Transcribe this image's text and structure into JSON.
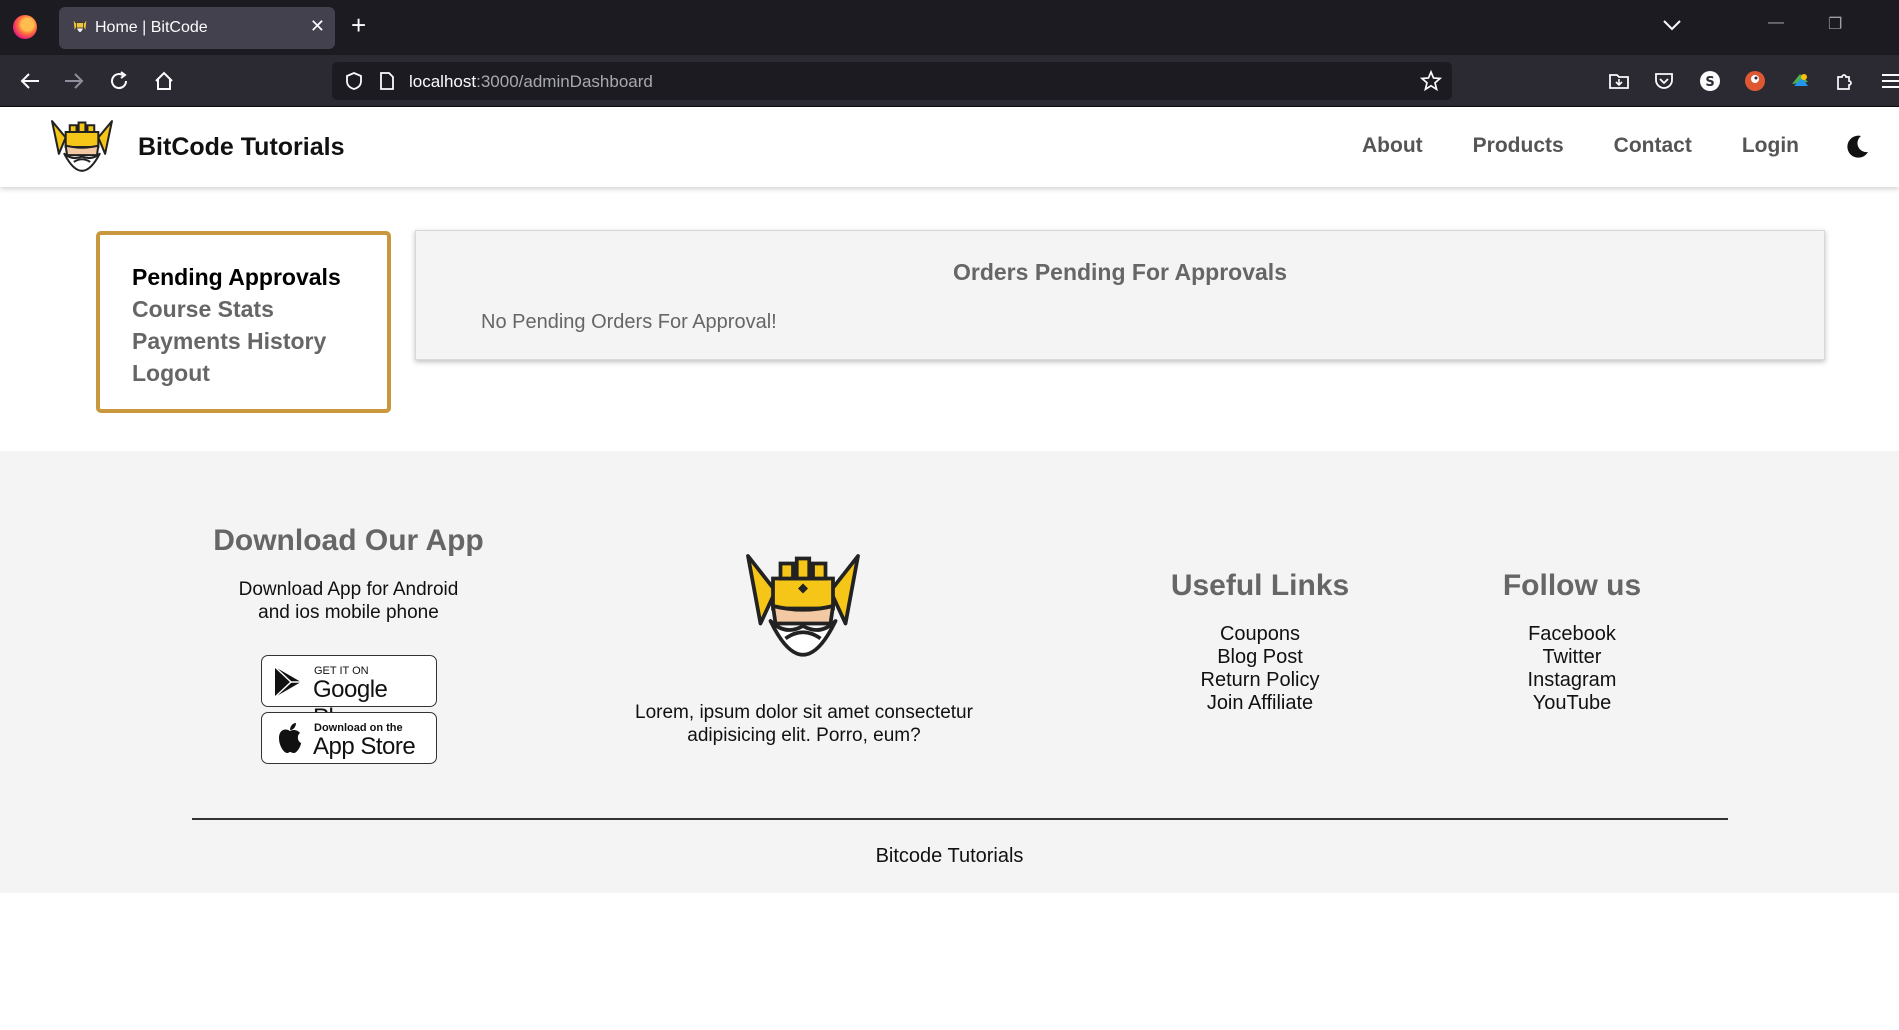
{
  "browser": {
    "tab_title": "Home | BitCode",
    "tab_close": "✕",
    "new_tab": "+",
    "url_host": "localhost",
    "url_path": ":3000/adminDashboard"
  },
  "header": {
    "brand": "BitCode Tutorials",
    "nav": [
      "About",
      "Products",
      "Contact",
      "Login"
    ]
  },
  "sidebar": {
    "items": [
      "Pending Approvals",
      "Course Stats",
      "Payments History",
      "Logout"
    ],
    "active": "Pending Approvals",
    "accent_color": "#c8973e"
  },
  "orders": {
    "title": "Orders Pending For Approvals",
    "empty_message": "No Pending Orders For Approval!"
  },
  "footer": {
    "app": {
      "heading": "Download Our App",
      "text_line1": "Download App for Android",
      "text_line2": "and ios mobile phone",
      "google_small": "GET IT ON",
      "google_big": "Google Play",
      "apple_small": "Download on the",
      "apple_big": "App Store"
    },
    "about": {
      "text_line1": "Lorem, ipsum dolor sit amet consectetur",
      "text_line2": "adipisicing elit. Porro, eum?"
    },
    "useful_links": {
      "heading": "Useful Links",
      "items": [
        "Coupons",
        "Blog Post",
        "Return Policy",
        "Join Affiliate"
      ]
    },
    "follow": {
      "heading": "Follow us",
      "items": [
        "Facebook",
        "Twitter",
        "Instagram",
        "YouTube"
      ]
    },
    "copyright": "Bitcode Tutorials"
  }
}
